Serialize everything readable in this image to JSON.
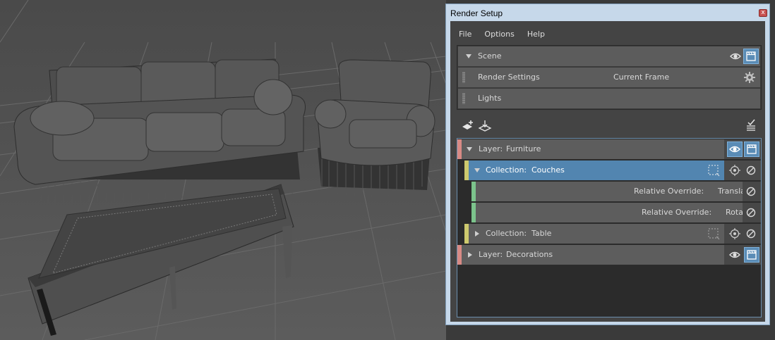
{
  "window": {
    "title": "Render Setup",
    "close_glyph": "x"
  },
  "menu": [
    "File",
    "Options",
    "Help"
  ],
  "scene": {
    "label": "Scene",
    "rows": [
      {
        "label": "Render Settings",
        "value": "Current Frame"
      },
      {
        "label": "Lights"
      }
    ]
  },
  "layers": [
    {
      "type": "Layer:",
      "name": "Furniture",
      "expanded": true
    },
    {
      "type": "Collection:",
      "name": "Couches",
      "expanded": true,
      "selected": true
    },
    {
      "type": "Relative Override:",
      "name": "Translate"
    },
    {
      "type": "Relative Override:",
      "name": "Rotate"
    },
    {
      "type": "Collection:",
      "name": "Table",
      "expanded": false
    },
    {
      "type": "Layer:",
      "name": "Decorations",
      "expanded": false
    }
  ],
  "icons": {
    "scene_toggle": "eye-icon",
    "scene_render": "clapper-icon",
    "settings": "gear-icon",
    "create_layer": "create-layer-icon",
    "import": "import-icon",
    "render_all": "checklist-icon",
    "isolate": "isolate-icon",
    "enable": "disable-icon",
    "select": "select-members-icon"
  },
  "colors": {
    "layer_strip": "#d88a85",
    "collection_strip": "#cdc96e",
    "override_strip": "#7cc38c",
    "selected": "#5285b0",
    "render_active": "#5a8cb6"
  }
}
